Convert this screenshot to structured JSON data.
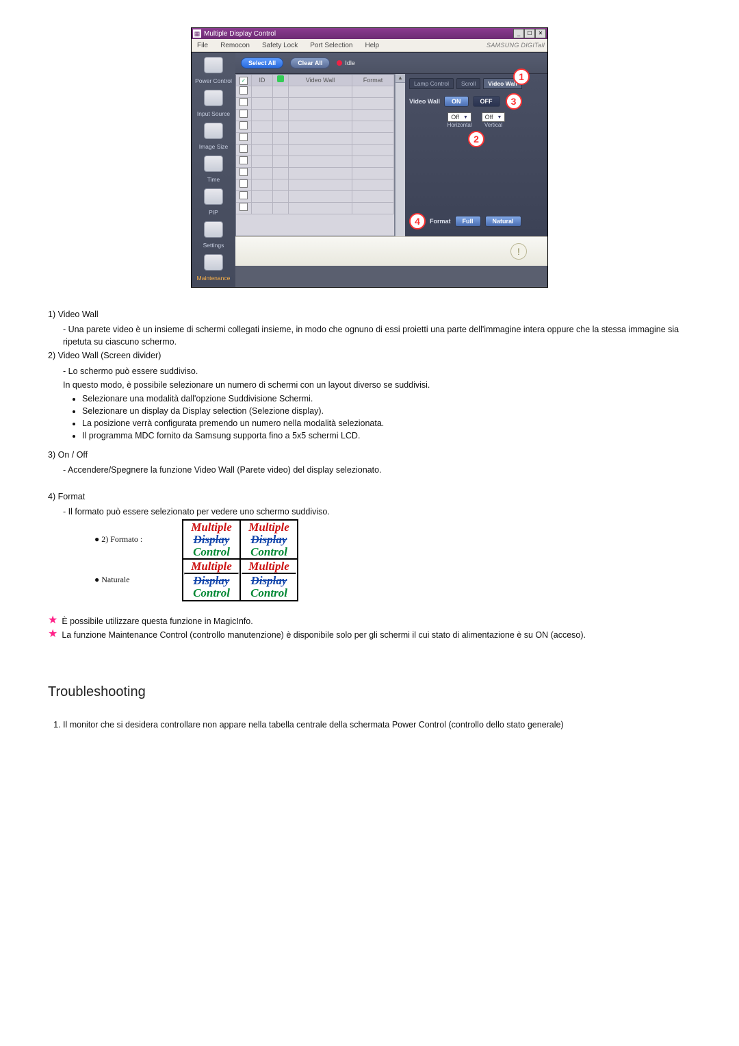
{
  "app": {
    "title": "Multiple Display Control",
    "win_min": "_",
    "win_max": "☐",
    "win_close": "✕",
    "menu": [
      "File",
      "Remocon",
      "Safety Lock",
      "Port Selection",
      "Help"
    ],
    "brand": "SAMSUNG DIGITall"
  },
  "sidebar": [
    {
      "label": "Power Control"
    },
    {
      "label": "Input Source"
    },
    {
      "label": "Image Size"
    },
    {
      "label": "Time"
    },
    {
      "label": "PIP"
    },
    {
      "label": "Settings"
    },
    {
      "label": "Maintenance",
      "active": true
    }
  ],
  "toolbar": {
    "select_all": "Select All",
    "clear_all": "Clear All",
    "idle": "Idle"
  },
  "table": {
    "cols": [
      "",
      "ID",
      "",
      "Video Wall",
      "Format"
    ],
    "rows": 11
  },
  "right": {
    "tabs": [
      "Lamp Control",
      "Scroll",
      "Video Wall"
    ],
    "activeTab": 2,
    "vw_label": "Video Wall",
    "on": "ON",
    "off": "OFF",
    "h_val": "Off",
    "v_val": "Off",
    "h_cap": "Horizontal",
    "v_cap": "Vertical",
    "fmt_label": "Format",
    "full": "Full",
    "natural": "Natural"
  },
  "callouts": {
    "c1": "1",
    "c2": "2",
    "c3": "3",
    "c4": "4"
  },
  "doc": {
    "i1": {
      "num": "1)",
      "title": "Video Wall",
      "d1": "Una parete video è un insieme di schermi collegati insieme, in modo che ognuno di essi proietti una parte dell'immagine intera oppure che la stessa immagine sia ripetuta su ciascuno schermo."
    },
    "i2": {
      "num": "2)",
      "title": "Video Wall (Screen divider)",
      "d1": "Lo schermo può essere suddiviso.",
      "d2": "In questo modo, è possibile selezionare un numero di schermi con un layout diverso se suddivisi.",
      "b": [
        "Selezionare una modalità dall'opzione Suddivisione Schermi.",
        "Selezionare un display da Display selection (Selezione display).",
        "La posizione verrà configurata premendo un numero nella modalità selezionata.",
        "Il programma MDC fornito da Samsung supporta fino a 5x5 schermi LCD."
      ]
    },
    "i3": {
      "num": "3)",
      "title": "On / Off",
      "d1": "Accendere/Spegnere la funzione Video Wall (Parete video) del display selezionato."
    },
    "i4": {
      "num": "4)",
      "title": "Format",
      "d1": "Il formato può essere selezionato per vedere uno schermo suddiviso.",
      "row1": "2) Formato :",
      "row2": "Naturale"
    },
    "mdc": {
      "l1": "Multiple",
      "l2": "Display",
      "l3": "Control"
    },
    "stars": [
      "È possibile utilizzare questa funzione in MagicInfo.",
      "La funzione Maintenance Control (controllo manutenzione) è disponibile solo per gli schermi il cui stato di alimentazione è su ON (acceso)."
    ]
  },
  "troubleshooting": {
    "heading": "Troubleshooting",
    "item1": "Il monitor che si desidera controllare non appare nella tabella centrale della schermata Power Control (controllo dello stato generale)"
  }
}
